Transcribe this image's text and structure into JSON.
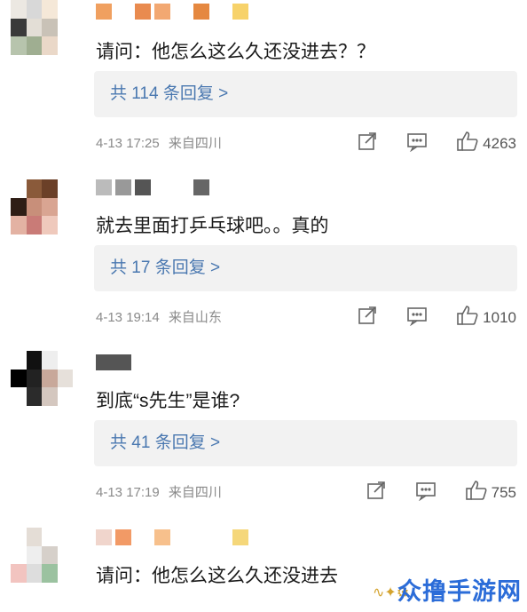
{
  "comments": [
    {
      "text": "请问：他怎么这么久还没进去？？",
      "replies_label": "共 114 条回复 >",
      "timestamp": "4-13 17:25",
      "location": "来自四川",
      "likes": "4263"
    },
    {
      "text": "就去里面打乒乓球吧。。真的",
      "replies_label": "共 17 条回复 >",
      "timestamp": "4-13 19:14",
      "location": "来自山东",
      "likes": "1010"
    },
    {
      "text": "到底“s先生”是谁?",
      "replies_label": "共 41 条回复 >",
      "timestamp": "4-13 17:19",
      "location": "来自四川",
      "likes": "755"
    },
    {
      "text": "请问：他怎么这么久还没进去"
    }
  ],
  "icons": {
    "share": "share-icon",
    "comment": "comment-icon",
    "like": "thumbs-up-icon"
  },
  "colors": {
    "link": "#4a78b0",
    "reply_bg": "#f2f2f2",
    "meta": "#8a8a8a"
  },
  "watermark": "众撸手游网"
}
